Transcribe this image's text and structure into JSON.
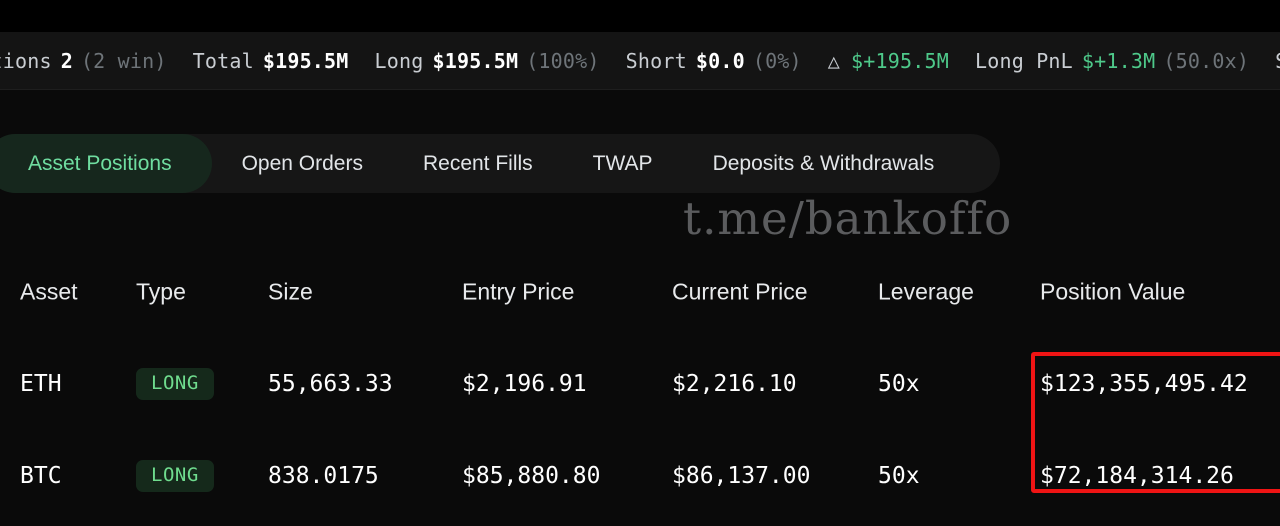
{
  "status_bar": {
    "items": [
      {
        "label": "sitions",
        "value": "2",
        "sub": "(2 win)",
        "value_color": "white"
      },
      {
        "label": "Total",
        "value": "$195.5M",
        "sub": "",
        "value_color": "white"
      },
      {
        "label": "Long",
        "value": "$195.5M",
        "sub": "(100%)",
        "value_color": "white"
      },
      {
        "label": "Short",
        "value": "$0.0",
        "sub": "(0%)",
        "value_color": "white"
      },
      {
        "label": "",
        "icon": "delta-triangle-icon",
        "value": "$+195.5M",
        "sub": "",
        "value_color": "green"
      },
      {
        "label": "Long PnL",
        "value": "$+1.3M",
        "sub": "(50.0x)",
        "value_color": "green"
      },
      {
        "label": "Sh",
        "value": "",
        "sub": "",
        "value_color": "white"
      }
    ],
    "delta_glyph": "△"
  },
  "tabs": {
    "items": [
      {
        "label": "Asset Positions",
        "active": true
      },
      {
        "label": "Open Orders",
        "active": false
      },
      {
        "label": "Recent Fills",
        "active": false
      },
      {
        "label": "TWAP",
        "active": false
      },
      {
        "label": "Deposits & Withdrawals",
        "active": false
      }
    ]
  },
  "watermark": {
    "text": "t.me/bankoffo"
  },
  "table": {
    "headers": {
      "asset": "Asset",
      "type": "Type",
      "size": "Size",
      "entry_price": "Entry Price",
      "current_price": "Current Price",
      "leverage": "Leverage",
      "position_value": "Position Value"
    },
    "rows": [
      {
        "asset": "ETH",
        "type": "LONG",
        "size": "55,663.33",
        "entry_price": "$2,196.91",
        "current_price": "$2,216.10",
        "leverage": "50x",
        "position_value": "$123,355,495.42"
      },
      {
        "asset": "BTC",
        "type": "LONG",
        "size": "838.0175",
        "entry_price": "$85,880.80",
        "current_price": "$86,137.00",
        "leverage": "50x",
        "position_value": "$72,184,314.26"
      }
    ]
  },
  "annotation": {
    "color": "#f01414",
    "target": "position-value-column"
  },
  "colors": {
    "background": "#0a0a0a",
    "status_bar_bg": "#141414",
    "accent_green": "#4ec98a",
    "tab_active_bg": "#16271d",
    "tab_active_text": "#6fdda0",
    "badge_long_bg": "#15291b",
    "badge_long_text": "#6fdc8e",
    "annotation_red": "#f01414"
  }
}
